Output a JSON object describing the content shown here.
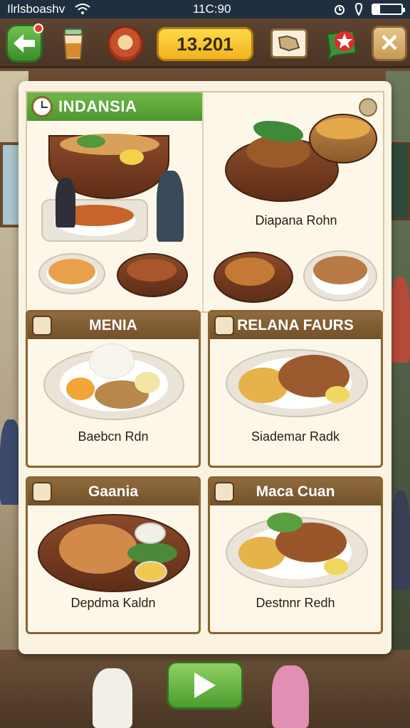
{
  "status_bar": {
    "carrier": "Ilrlsboashv",
    "time": "11С:90",
    "battery_level": 0.25
  },
  "toolbar": {
    "coins": "13.201",
    "icons": [
      "back-arrow-icon",
      "drink-icon",
      "bowl-icon",
      "map-icon",
      "star-icon",
      "close-icon"
    ]
  },
  "featured": {
    "title": "INDANSIA",
    "dish_label": "Diapana Rohn"
  },
  "cards": [
    {
      "title": "MENIA",
      "label": "Baebcn Rdn"
    },
    {
      "title": "RELANA FAURS",
      "label": "Siademar Radk"
    },
    {
      "title": "Gaania",
      "label": "Depdma Kaldn"
    },
    {
      "title": "Maca Cuan",
      "label": "Destnnr Redh"
    }
  ],
  "colors": {
    "accent_green": "#4f9630",
    "card_header": "#8a6332",
    "coin_gold": "#ffd94a",
    "panel_bg": "#fbf3e1"
  }
}
